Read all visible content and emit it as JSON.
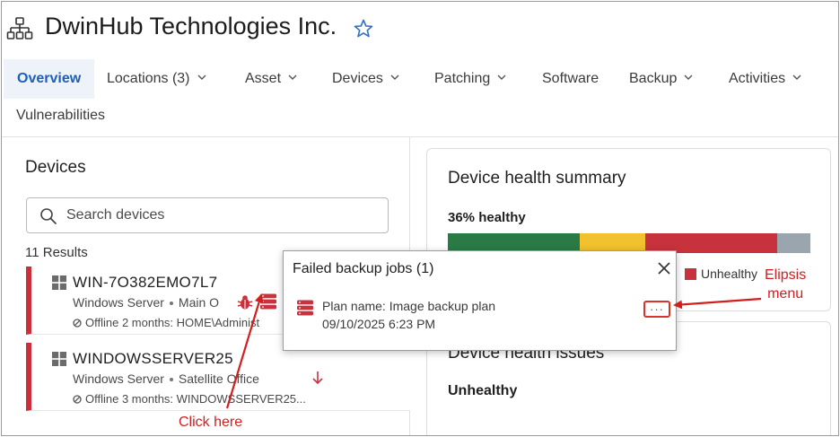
{
  "header": {
    "org_name": "DwinHub Technologies Inc.",
    "org_icon": "org-hierarchy-icon",
    "favorite_icon": "star-outline-icon"
  },
  "tabs": {
    "overview": "Overview",
    "locations": "Locations (3)",
    "asset": "Asset",
    "devices": "Devices",
    "patching": "Patching",
    "software": "Software",
    "backup": "Backup",
    "activities": "Activities",
    "vulnerabilities": "Vulnerabilities"
  },
  "devices_panel": {
    "title": "Devices",
    "search_placeholder": "Search devices",
    "results": "11 Results",
    "items": [
      {
        "name": "WIN-7O382EMO7L7",
        "type": "Windows Server",
        "location": "Main O",
        "status": "Offline 2 months: HOME\\Administ"
      },
      {
        "name": "WINDOWSSERVER25",
        "type": "Windows Server",
        "location": "Satellite Office",
        "status": "Offline 3 months: WINDOWSSERVER25..."
      }
    ]
  },
  "health_summary": {
    "title": "Device health summary",
    "healthy_pct": "36% healthy",
    "segments": [
      {
        "status": "healthy",
        "fraction": 0.36,
        "color": "#2a7a46"
      },
      {
        "status": "warning",
        "fraction": 0.18,
        "color": "#f2c12e"
      },
      {
        "status": "unhealthy",
        "fraction": 0.36,
        "color": "#c8323c"
      },
      {
        "status": "unknown",
        "fraction": 0.09,
        "color": "#9aa5ad"
      }
    ],
    "legend_unhealthy": "Unhealthy"
  },
  "health_issues": {
    "title": "Device health issues",
    "subtitle": "Unhealthy"
  },
  "popup": {
    "title": "Failed backup jobs (1)",
    "plan": "Plan name: Image backup plan",
    "date": "09/10/2025 6:23 PM",
    "ellipsis_label": "···"
  },
  "annotations": {
    "click_here": "Click here",
    "ellipsis_line1": "Elipsis",
    "ellipsis_line2": "menu",
    "color": "#d11f1f"
  },
  "colors": {
    "accent": "#1d5fb7",
    "alert": "#cc2f3a"
  }
}
